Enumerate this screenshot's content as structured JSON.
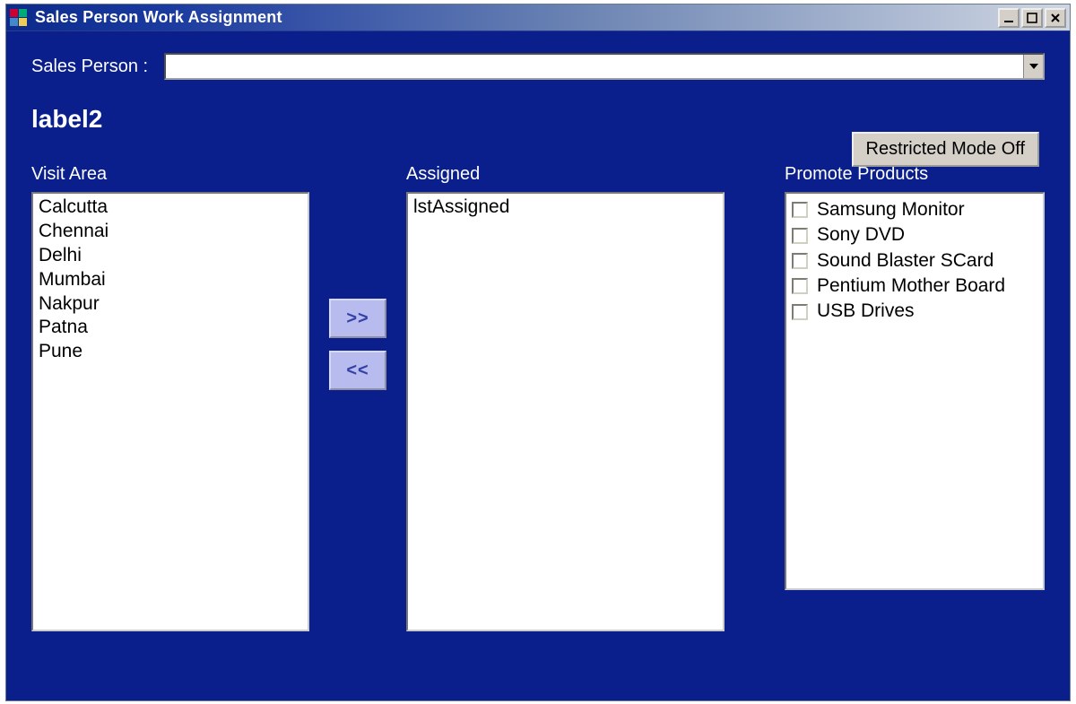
{
  "window": {
    "title": "Sales Person Work Assignment"
  },
  "labels": {
    "salesPerson": "Sales Person :",
    "label2": "label2",
    "restrictedMode": "Restricted Mode Off",
    "visitArea": "Visit Area",
    "assigned": "Assigned",
    "promoteProducts": "Promote Products",
    "moveRight": ">>",
    "moveLeft": "<<"
  },
  "salesPersonValue": "",
  "visitAreaItems": [
    "Calcutta",
    "Chennai",
    "Delhi",
    "Mumbai",
    "Nakpur",
    "Patna",
    "Pune"
  ],
  "assignedItems": [
    "lstAssigned"
  ],
  "productItems": [
    {
      "label": "Samsung Monitor",
      "checked": false
    },
    {
      "label": "Sony DVD",
      "checked": false
    },
    {
      "label": "Sound Blaster SCard",
      "checked": false
    },
    {
      "label": "Pentium Mother Board",
      "checked": false
    },
    {
      "label": "USB Drives",
      "checked": false
    }
  ]
}
